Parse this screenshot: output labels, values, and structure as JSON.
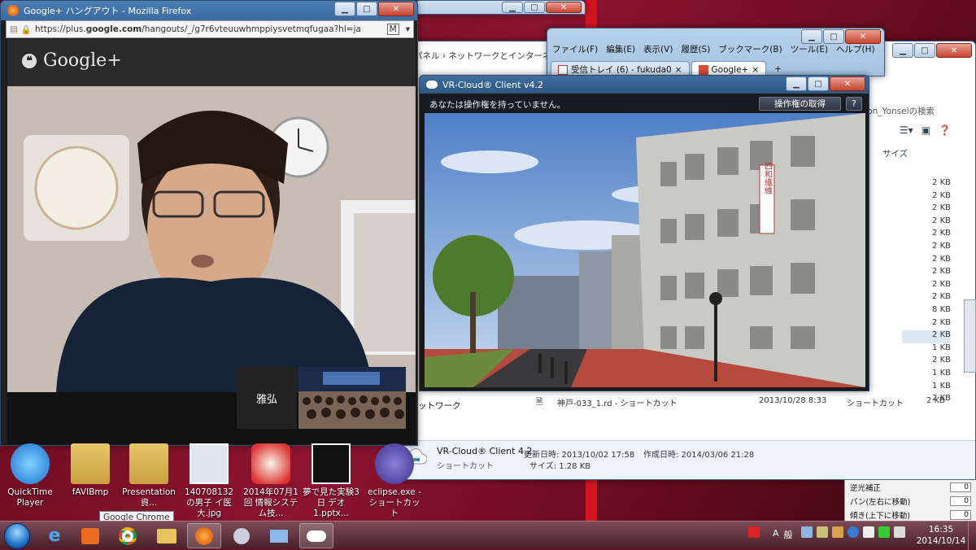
{
  "firefox": {
    "title": "Google+ ハングアウト - Mozilla Firefox",
    "url_prefix": "https://plus.",
    "url_host": "google.com",
    "url_path": "/hangouts/_/g7r6vteuuwhmppiysvetmqfugaa?hl=ja",
    "brand": "Google+",
    "participant_name": "雅弘"
  },
  "chrome": {
    "menu": [
      "ファイル(F)",
      "編集(E)",
      "表示(V)",
      "履歴(S)",
      "ブックマーク(B)",
      "ツール(E)",
      "ヘルプ(H)"
    ],
    "tabs": [
      {
        "label": "受信トレイ (6) - fukuda0",
        "active": false
      },
      {
        "label": "Google+",
        "active": true
      }
    ],
    "new_tab": "+"
  },
  "explorer": {
    "breadcrumb": "パネル › ネットワークとインターネ",
    "search_placeholder": "ation_Yonseiの検索",
    "size_header": "サイズ",
    "sizes": [
      "2 KB",
      "2 KB",
      "2 KB",
      "2 KB",
      "2 KB",
      "2 KB",
      "2 KB",
      "2 KB",
      "2 KB",
      "2 KB",
      "8 KB",
      "2 KB",
      "2 KB",
      "1 KB",
      "2 KB",
      "1 KB",
      "1 KB",
      "2 KB"
    ],
    "selected_index": 12,
    "network_label": "ットワーク",
    "file": {
      "name": "神戸-033_1.rd - ショートカット",
      "date": "2013/10/28 8:33",
      "type": "ショートカット",
      "size": "2 KB"
    },
    "details": {
      "name": "VR-Cloud® Client 4.2",
      "kind": "ショートカット",
      "modified": "更新日時: 2013/10/02 17:58",
      "created": "作成日時: 2014/03/06 21:28",
      "size": "サイズ: 1.28 KB"
    }
  },
  "vr": {
    "title": "VR-Cloud® Client v4.2",
    "status": "あなたは操作権を持っていません。",
    "acquire_button": "操作権の取得",
    "help": "?",
    "building_sign": "四和繊維"
  },
  "camera_panel": {
    "rows": [
      {
        "label": "逆光補正",
        "value": "0"
      },
      {
        "label": "パン(左右に移動)",
        "value": "0"
      },
      {
        "label": "傾き(上下に移動)",
        "value": "0"
      }
    ]
  },
  "desktop_icons": [
    {
      "label": "QuickTime Player"
    },
    {
      "label": "fAVIBmp"
    },
    {
      "label": "Presentation資..."
    },
    {
      "label": "140708132の男子 イ医大.jpg"
    },
    {
      "label": "2014年07月1回 情報システム技..."
    },
    {
      "label": "夢で見た実験3日 デオ1.pptx..."
    },
    {
      "label": "eclipse.exe - ショートカット"
    }
  ],
  "tooltip": "Google Chrome",
  "taskbar": {
    "ime": [
      "A",
      "般"
    ],
    "time": "16:35",
    "date": "2014/10/14"
  },
  "colors": {
    "taskbar": "#5a2a35",
    "vr_titlebar": "#2c5680",
    "firefox_titlebar": "#3a6aa0"
  }
}
